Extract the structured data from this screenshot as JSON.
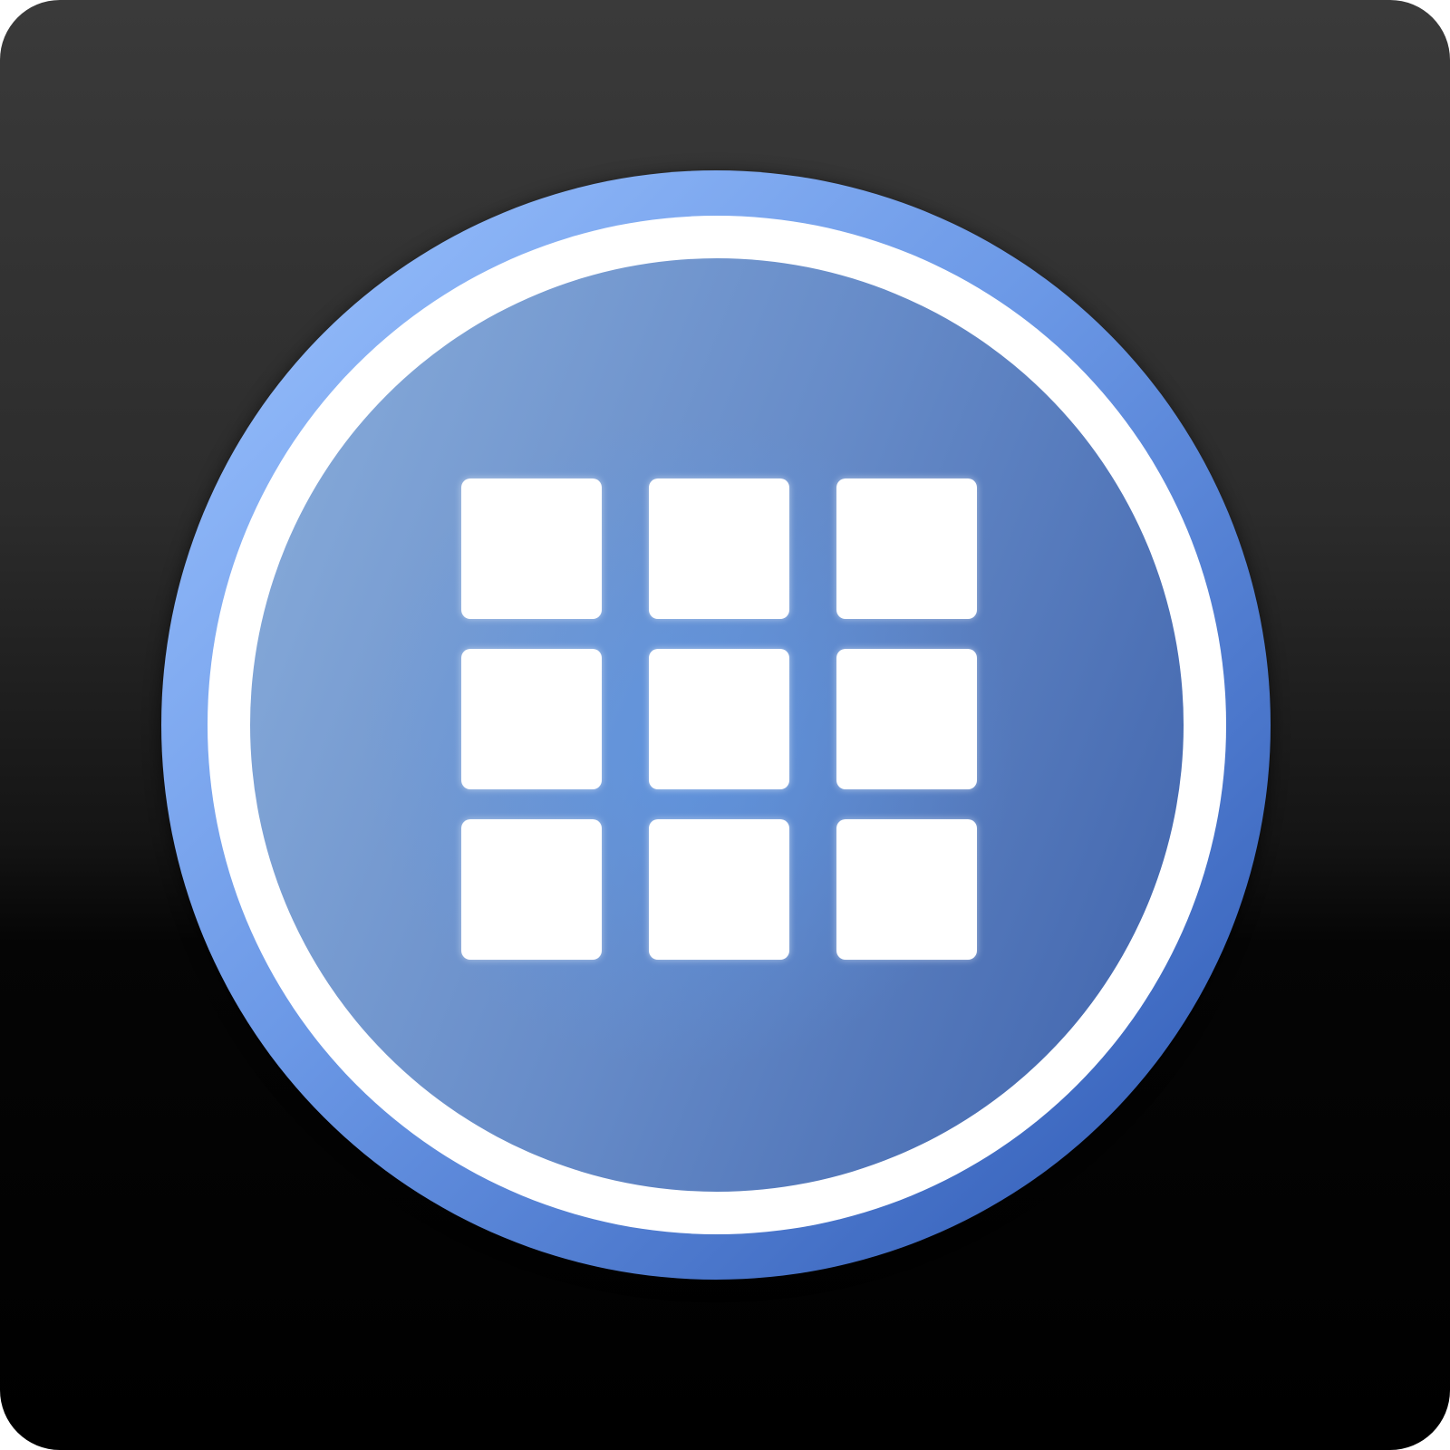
{
  "icon": {
    "name": "app-grid-icon",
    "description_glyph": "grid-3x3",
    "grid": {
      "rows": 3,
      "cols": 3
    },
    "colors": {
      "tile_background_top": "#3a3a3a",
      "tile_background_bottom": "#000000",
      "outer_ring_light": "#8ab4f8",
      "outer_ring_dark": "#2f5bb8",
      "inner_ring": "#ffffff",
      "disc_light": "#7ea2d4",
      "disc_dark": "#4a6fb4",
      "grid_squares": "#ffffff"
    }
  }
}
